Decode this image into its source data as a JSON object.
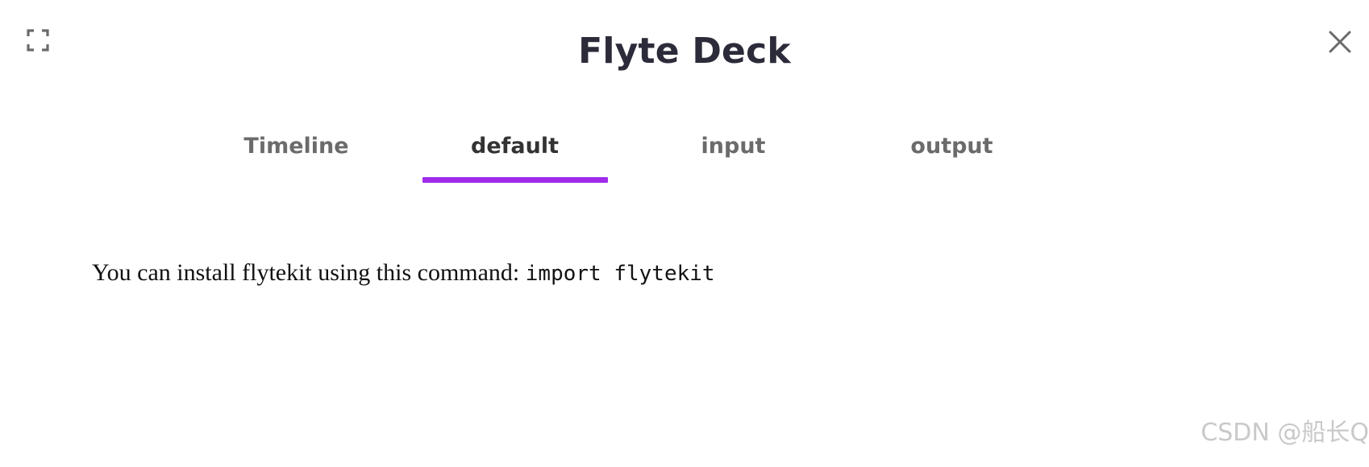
{
  "header": {
    "title": "Flyte Deck",
    "expand_icon": "expand-icon",
    "close_icon": "close-icon"
  },
  "tabs": [
    {
      "label": "Timeline",
      "active": false
    },
    {
      "label": "default",
      "active": true
    },
    {
      "label": "input",
      "active": false
    },
    {
      "label": "output",
      "active": false
    }
  ],
  "colors": {
    "accent": "#a02bea",
    "title": "#2b2b3a",
    "tab_inactive": "#6b6b6b",
    "watermark": "#c9c9c9"
  },
  "content": {
    "text": "You can install flytekit using this command:",
    "code": "import flytekit"
  },
  "watermark": "CSDN @船长Q"
}
